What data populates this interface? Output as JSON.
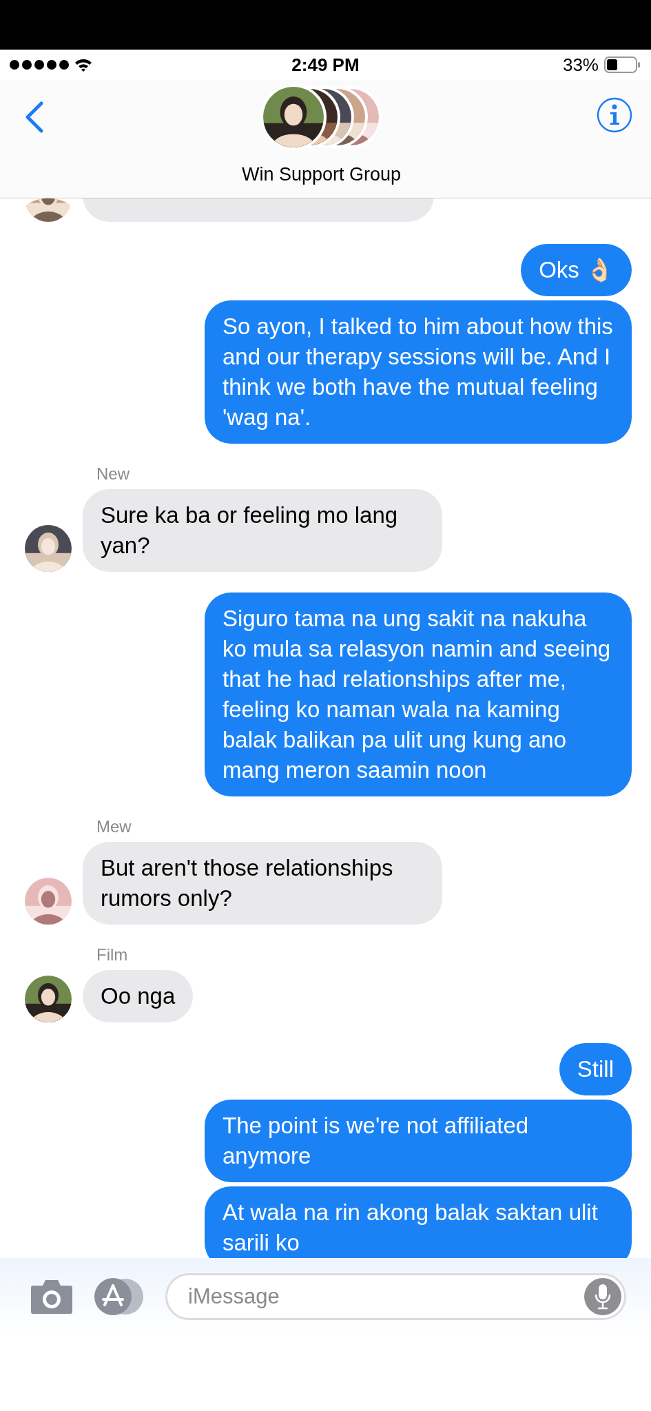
{
  "status_bar": {
    "time": "2:49 PM",
    "battery_percent": "33%"
  },
  "header": {
    "title": "Win Support Group"
  },
  "messages": [
    {
      "kind": "sent",
      "text": "Oks 👌🏻"
    },
    {
      "kind": "sent",
      "text": "So ayon, I talked to him about how this and our therapy sessions will be. And I think we both have the mutual feeling 'wag na'."
    },
    {
      "kind": "received",
      "sender": "New",
      "text": "Sure ka ba or feeling mo lang yan?"
    },
    {
      "kind": "sent",
      "text": "Siguro tama na ung sakit na nakuha ko mula sa relasyon namin and seeing that he had relationships after me, feeling ko naman wala na kaming balak balikan pa ulit ung kung ano mang meron saamin noon"
    },
    {
      "kind": "received",
      "sender": "Mew",
      "text": "But aren't those relationships rumors only?"
    },
    {
      "kind": "received",
      "sender": "Film",
      "text": "Oo nga"
    },
    {
      "kind": "sent",
      "text": "Still"
    },
    {
      "kind": "sent",
      "text": "The point is we're not affiliated anymore"
    },
    {
      "kind": "sent",
      "text": "At wala na rin akong balak saktan ulit sarili ko"
    }
  ],
  "composer": {
    "placeholder": "iMessage"
  }
}
